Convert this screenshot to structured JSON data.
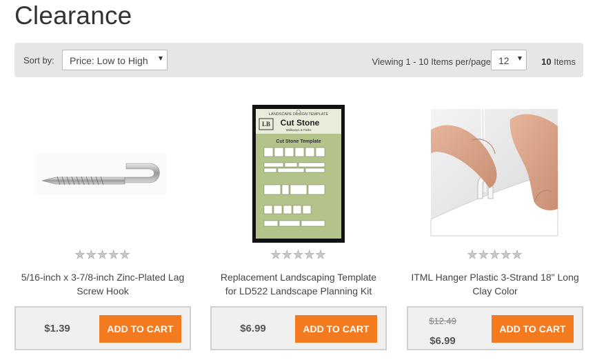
{
  "page_title": "Clearance",
  "toolbar": {
    "sort_label": "Sort by:",
    "sort_value": "Price: Low to High",
    "viewing_label": "Viewing 1 - 10 Items per/page",
    "per_page_value": "12",
    "count_number": "10",
    "count_suffix": "Items"
  },
  "products": [
    {
      "name_line1": "5/16-inch x 3-7/8-inch Zinc-Plated Lag",
      "name_line2": "Screw Hook",
      "price": "$1.39",
      "rating": 0,
      "stars": "★★★★★",
      "button": "ADD TO CART"
    },
    {
      "name_line1": "Replacement Landscaping Template",
      "name_line2": "for LD522 Landscape Planning Kit",
      "price": "$6.99",
      "rating": 0,
      "stars": "★★★★★",
      "button": "ADD TO CART",
      "image_text": {
        "header": "LANDSCAPE DESIGN TEMPLATE",
        "brand": "Cut Stone",
        "sub": "Walkways & Paths",
        "inner_title": "Cut Stone Template"
      }
    },
    {
      "name_line1": "ITML Hanger Plastic 3-Strand 18\" Long",
      "name_line2": "Clay Color",
      "old_price": "$12.49",
      "price": "$6.99",
      "rating": 0,
      "stars": "★★★★★",
      "button": "ADD TO CART"
    }
  ],
  "colors": {
    "accent_button": "#f47a20",
    "toolbar_bg": "#e6e6e6"
  }
}
